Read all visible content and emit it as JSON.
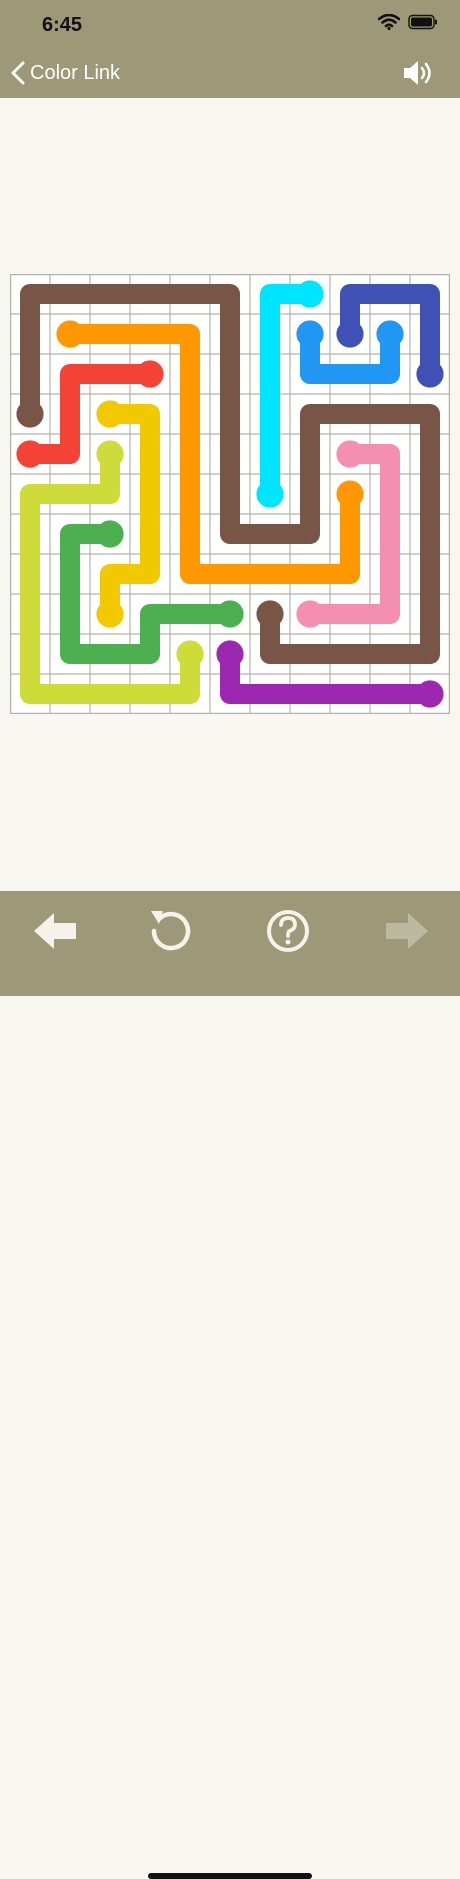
{
  "status": {
    "time": "6:45"
  },
  "nav": {
    "back_label": "Color Link"
  },
  "icons": {
    "back": "chevron-left-icon",
    "sound": "speaker-icon",
    "prev": "arrow-left-icon",
    "restart": "restart-icon",
    "help": "help-icon",
    "next": "arrow-right-icon"
  },
  "board": {
    "grid_size": 11,
    "cell_color": "#ffffff",
    "line_color": "#b3b3a8",
    "paths": [
      {
        "name": "brown-1",
        "color": "#795548",
        "cells": [
          [
            0,
            3
          ],
          [
            0,
            2
          ],
          [
            0,
            1
          ],
          [
            0,
            0
          ],
          [
            1,
            0
          ],
          [
            2,
            0
          ],
          [
            3,
            0
          ],
          [
            4,
            0
          ],
          [
            5,
            0
          ],
          [
            5,
            1
          ],
          [
            5,
            2
          ],
          [
            5,
            3
          ],
          [
            5,
            4
          ],
          [
            5,
            5
          ],
          [
            5,
            6
          ],
          [
            6,
            6
          ],
          [
            7,
            6
          ],
          [
            7,
            5
          ],
          [
            7,
            4
          ],
          [
            7,
            3
          ],
          [
            8,
            3
          ],
          [
            9,
            3
          ],
          [
            10,
            3
          ],
          [
            10,
            4
          ],
          [
            10,
            5
          ],
          [
            10,
            6
          ],
          [
            10,
            7
          ],
          [
            10,
            8
          ],
          [
            10,
            9
          ],
          [
            9,
            9
          ],
          [
            8,
            9
          ],
          [
            7,
            9
          ],
          [
            6,
            9
          ],
          [
            6,
            8
          ]
        ]
      },
      {
        "name": "orange",
        "color": "#ff9800",
        "cells": [
          [
            1,
            1
          ],
          [
            2,
            1
          ],
          [
            3,
            1
          ],
          [
            4,
            1
          ],
          [
            4,
            2
          ],
          [
            4,
            3
          ],
          [
            4,
            4
          ],
          [
            4,
            5
          ],
          [
            4,
            6
          ],
          [
            4,
            7
          ],
          [
            5,
            7
          ],
          [
            6,
            7
          ],
          [
            7,
            7
          ],
          [
            8,
            7
          ],
          [
            8,
            6
          ],
          [
            8,
            5
          ]
        ]
      },
      {
        "name": "red",
        "color": "#f44336",
        "cells": [
          [
            0,
            4
          ],
          [
            1,
            4
          ],
          [
            1,
            3
          ],
          [
            1,
            2
          ],
          [
            2,
            2
          ],
          [
            3,
            2
          ]
        ]
      },
      {
        "name": "yellow",
        "color": "#f2c800",
        "cells": [
          [
            2,
            3
          ],
          [
            3,
            3
          ],
          [
            3,
            4
          ],
          [
            3,
            5
          ],
          [
            3,
            6
          ],
          [
            3,
            7
          ],
          [
            2,
            7
          ],
          [
            2,
            8
          ]
        ]
      },
      {
        "name": "lime",
        "color": "#cddc39",
        "cells": [
          [
            2,
            4
          ],
          [
            2,
            5
          ],
          [
            1,
            5
          ],
          [
            0,
            5
          ],
          [
            0,
            6
          ],
          [
            0,
            7
          ],
          [
            0,
            8
          ],
          [
            0,
            9
          ],
          [
            0,
            10
          ],
          [
            1,
            10
          ],
          [
            2,
            10
          ],
          [
            3,
            10
          ],
          [
            4,
            10
          ],
          [
            4,
            9
          ]
        ]
      },
      {
        "name": "green",
        "color": "#4caf50",
        "cells": [
          [
            2,
            6
          ],
          [
            1,
            6
          ],
          [
            1,
            7
          ],
          [
            1,
            8
          ],
          [
            1,
            9
          ],
          [
            2,
            9
          ],
          [
            3,
            9
          ],
          [
            3,
            8
          ],
          [
            4,
            8
          ],
          [
            5,
            8
          ]
        ]
      },
      {
        "name": "cyan",
        "color": "#00e5ff",
        "cells": [
          [
            7,
            0
          ],
          [
            6,
            0
          ],
          [
            6,
            1
          ],
          [
            6,
            2
          ],
          [
            6,
            3
          ],
          [
            6,
            4
          ],
          [
            6,
            5
          ]
        ]
      },
      {
        "name": "navy",
        "color": "#3f51b5",
        "cells": [
          [
            8,
            1
          ],
          [
            8,
            0
          ],
          [
            9,
            0
          ],
          [
            10,
            0
          ],
          [
            10,
            1
          ],
          [
            10,
            2
          ]
        ]
      },
      {
        "name": "blue",
        "color": "#2196f3",
        "cells": [
          [
            7,
            1
          ],
          [
            7,
            2
          ],
          [
            8,
            2
          ],
          [
            9,
            2
          ],
          [
            9,
            1
          ]
        ]
      },
      {
        "name": "pink",
        "color": "#f48fb1",
        "cells": [
          [
            8,
            4
          ],
          [
            9,
            4
          ],
          [
            9,
            5
          ],
          [
            9,
            6
          ],
          [
            9,
            7
          ],
          [
            9,
            8
          ],
          [
            8,
            8
          ],
          [
            7,
            8
          ]
        ]
      },
      {
        "name": "purple",
        "color": "#9c27b0",
        "cells": [
          [
            5,
            9
          ],
          [
            5,
            10
          ],
          [
            6,
            10
          ],
          [
            7,
            10
          ],
          [
            8,
            10
          ],
          [
            9,
            10
          ],
          [
            10,
            10
          ]
        ]
      }
    ]
  }
}
